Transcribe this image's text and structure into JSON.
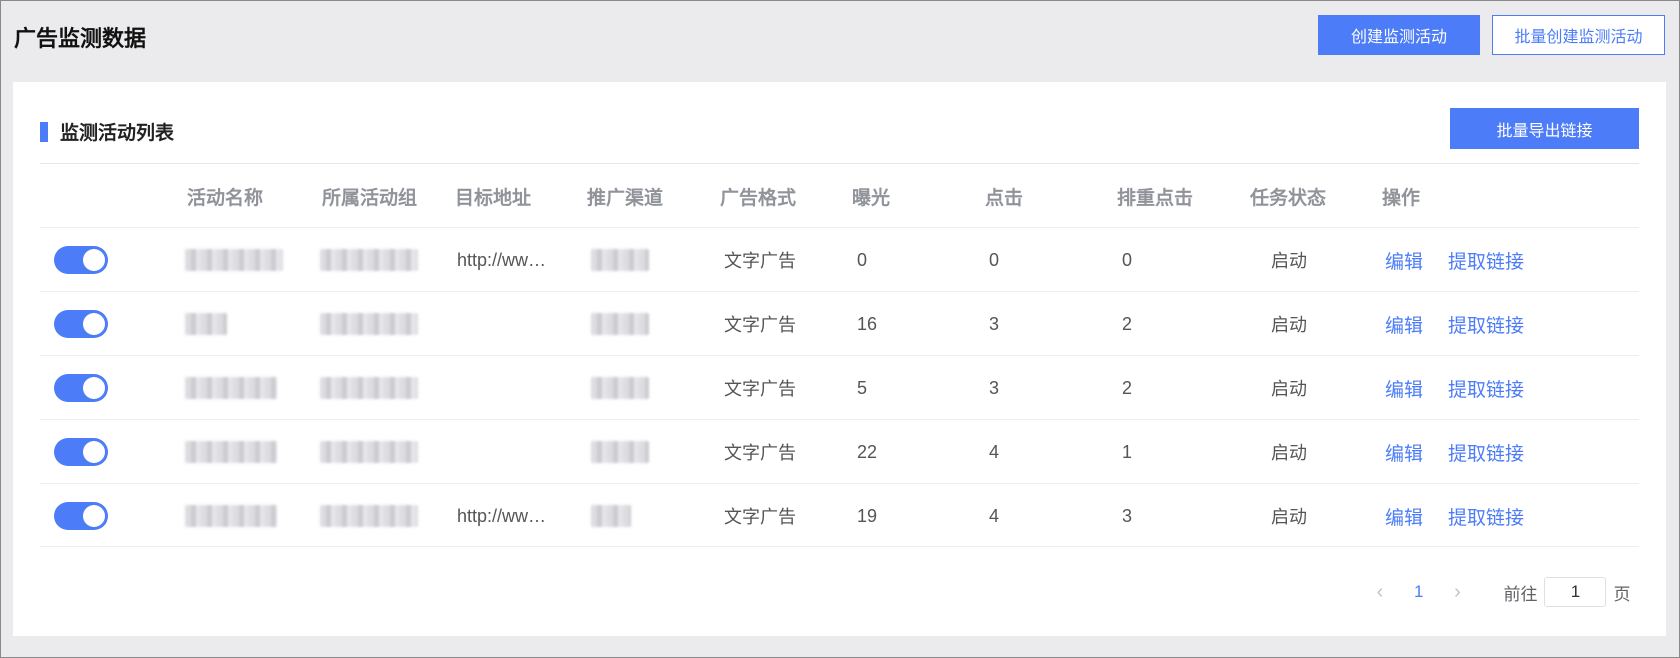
{
  "header": {
    "title": "广告监测数据",
    "create_label": "创建监测活动",
    "batch_create_label": "批量创建监测活动"
  },
  "section": {
    "title": "监测活动列表",
    "export_label": "批量导出链接"
  },
  "columns": [
    "活动名称",
    "所属活动组",
    "目标地址",
    "推广渠道",
    "广告格式",
    "曝光",
    "点击",
    "排重点击",
    "任务状态",
    "操作"
  ],
  "rows": [
    {
      "enabled": true,
      "target": "http://ww…",
      "format": "文字广告",
      "impressions": "0",
      "clicks": "0",
      "unique_clicks": "0",
      "status": "启动"
    },
    {
      "enabled": true,
      "target": "",
      "format": "文字广告",
      "impressions": "16",
      "clicks": "3",
      "unique_clicks": "2",
      "status": "启动"
    },
    {
      "enabled": true,
      "target": "",
      "format": "文字广告",
      "impressions": "5",
      "clicks": "3",
      "unique_clicks": "2",
      "status": "启动"
    },
    {
      "enabled": true,
      "target": "",
      "format": "文字广告",
      "impressions": "22",
      "clicks": "4",
      "unique_clicks": "1",
      "status": "启动"
    },
    {
      "enabled": true,
      "target": "http://ww…",
      "format": "文字广告",
      "impressions": "19",
      "clicks": "4",
      "unique_clicks": "3",
      "status": "启动"
    }
  ],
  "row_actions": {
    "edit": "编辑",
    "get_link": "提取链接"
  },
  "pagination": {
    "prev_icon": "chevron-left-icon",
    "next_icon": "chevron-right-icon",
    "current_page": "1",
    "goto_prefix": "前往",
    "goto_value": "1",
    "goto_suffix": "页"
  },
  "colors": {
    "accent": "#4c7cf8",
    "background": "#ebebee"
  }
}
